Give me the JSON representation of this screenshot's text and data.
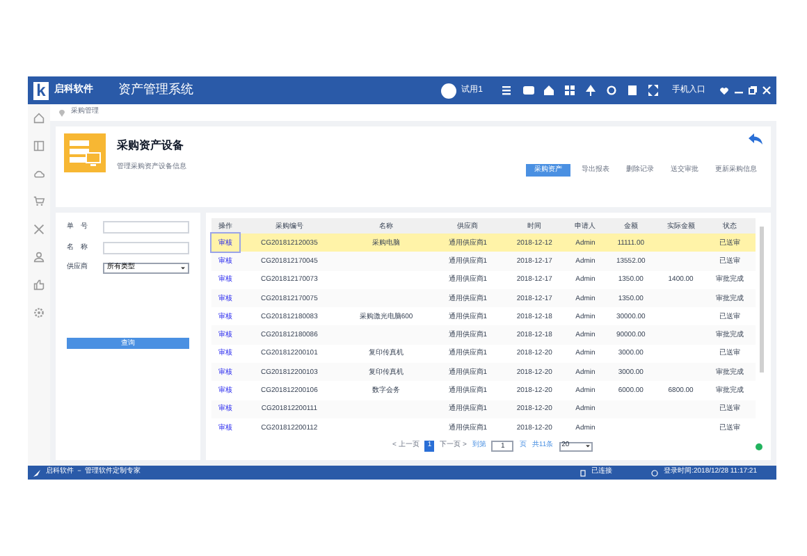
{
  "window": {
    "logo_letter": "k",
    "brand": "启科软件",
    "title": "资产管理系统",
    "user": "试用1",
    "mobile_entry": "手机入口"
  },
  "breadcrumb": "采购管理",
  "header": {
    "title": "采购资产设备",
    "subtitle": "管理采购资产设备信息"
  },
  "actions": [
    {
      "label": "采购资产",
      "primary": true
    },
    {
      "label": "导出报表",
      "primary": false
    },
    {
      "label": "删除记录",
      "primary": false
    },
    {
      "label": "送交审批",
      "primary": false
    },
    {
      "label": "更新采购信息",
      "primary": false
    }
  ],
  "filters": [
    {
      "kind": "text",
      "label": "单　号"
    },
    {
      "kind": "text",
      "label": "名　称"
    },
    {
      "kind": "select",
      "label": "供应商",
      "value": "所有类型"
    }
  ],
  "search_button": "查询",
  "table": {
    "columns": [
      "操作",
      "采购编号",
      "名称",
      "供应商",
      "时间",
      "申请人",
      "金额",
      "实际金额",
      "状态"
    ],
    "rows": [
      {
        "selected": true,
        "cells": [
          "审核",
          "CG201812120035",
          "采购电脑",
          "通用供应商1",
          "2018-12-12",
          "Admin",
          "11111.00",
          "",
          "已送审"
        ]
      },
      {
        "selected": false,
        "cells": [
          "审核",
          "CG201812170045",
          "",
          "通用供应商1",
          "2018-12-17",
          "Admin",
          "13552.00",
          "",
          "已送审"
        ]
      },
      {
        "selected": false,
        "cells": [
          "审核",
          "CG201812170073",
          "",
          "通用供应商1",
          "2018-12-17",
          "Admin",
          "1350.00",
          "1400.00",
          "审批完成"
        ]
      },
      {
        "selected": false,
        "cells": [
          "审核",
          "CG201812170075",
          "",
          "通用供应商1",
          "2018-12-17",
          "Admin",
          "1350.00",
          "",
          "审批完成"
        ]
      },
      {
        "selected": false,
        "cells": [
          "审核",
          "CG201812180083",
          "采购激光电脑600",
          "通用供应商1",
          "2018-12-18",
          "Admin",
          "30000.00",
          "",
          "已送审"
        ]
      },
      {
        "selected": false,
        "cells": [
          "审核",
          "CG201812180086",
          "",
          "通用供应商1",
          "2018-12-18",
          "Admin",
          "90000.00",
          "",
          "审批完成"
        ]
      },
      {
        "selected": false,
        "cells": [
          "审核",
          "CG201812200101",
          "复印传真机",
          "通用供应商1",
          "2018-12-20",
          "Admin",
          "3000.00",
          "",
          "已送审"
        ]
      },
      {
        "selected": false,
        "cells": [
          "审核",
          "CG201812200103",
          "复印传真机",
          "通用供应商1",
          "2018-12-20",
          "Admin",
          "3000.00",
          "",
          "审批完成"
        ]
      },
      {
        "selected": false,
        "cells": [
          "审核",
          "CG201812200106",
          "数字会务",
          "通用供应商1",
          "2018-12-20",
          "Admin",
          "6000.00",
          "6800.00",
          "审批完成"
        ]
      },
      {
        "selected": false,
        "cells": [
          "审核",
          "CG201812200111",
          "",
          "通用供应商1",
          "2018-12-20",
          "Admin",
          "",
          "",
          "已送审"
        ]
      },
      {
        "selected": false,
        "cells": [
          "审核",
          "CG201812200112",
          "",
          "通用供应商1",
          "2018-12-20",
          "Admin",
          "",
          "",
          "已送审"
        ]
      }
    ]
  },
  "pagination": {
    "prev": "< 上一页",
    "pages": [
      {
        "label": "1",
        "selected": true
      }
    ],
    "next": "下一页 >",
    "goto": "到第",
    "page_input": "1",
    "page_unit": "页",
    "total": "共11条",
    "page_size": "20"
  },
  "status_bar": {
    "left": "启科软件 － 管理软件定制专家",
    "connection": "已连接",
    "login_time": "登录时间:2018/12/28 11:17:21"
  }
}
